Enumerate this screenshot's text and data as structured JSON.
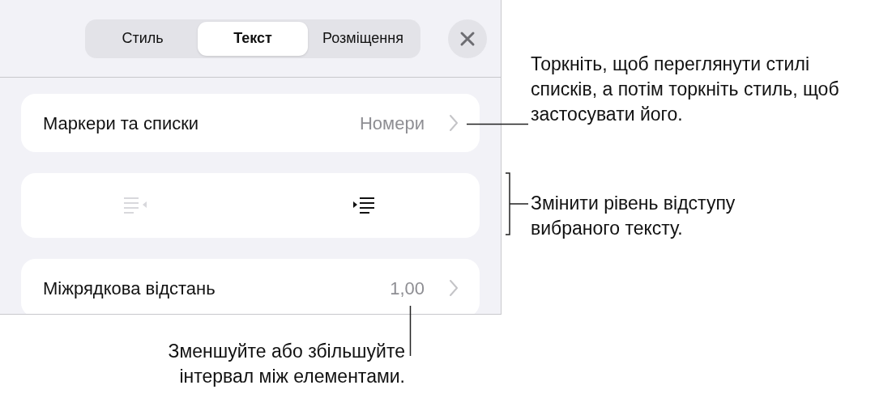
{
  "tabs": [
    {
      "label": "Стиль",
      "selected": false
    },
    {
      "label": "Текст",
      "selected": true
    },
    {
      "label": "Розміщення",
      "selected": false
    }
  ],
  "rows": [
    {
      "kind": "disclosure",
      "label": "Маркери та списки",
      "value": "Номери"
    },
    {
      "kind": "indent",
      "decrease_disabled": true,
      "increase_disabled": false
    },
    {
      "kind": "disclosure",
      "label": "Міжрядкова відстань",
      "value": "1,00"
    }
  ],
  "callouts": [
    "Торкніть, щоб переглянути стилі списків, а потім торкніть стиль, щоб застосувати його.",
    "Змінити рівень відступу вибраного тексту.",
    "Зменшуйте або збільшуйте інтервал між елементами."
  ]
}
